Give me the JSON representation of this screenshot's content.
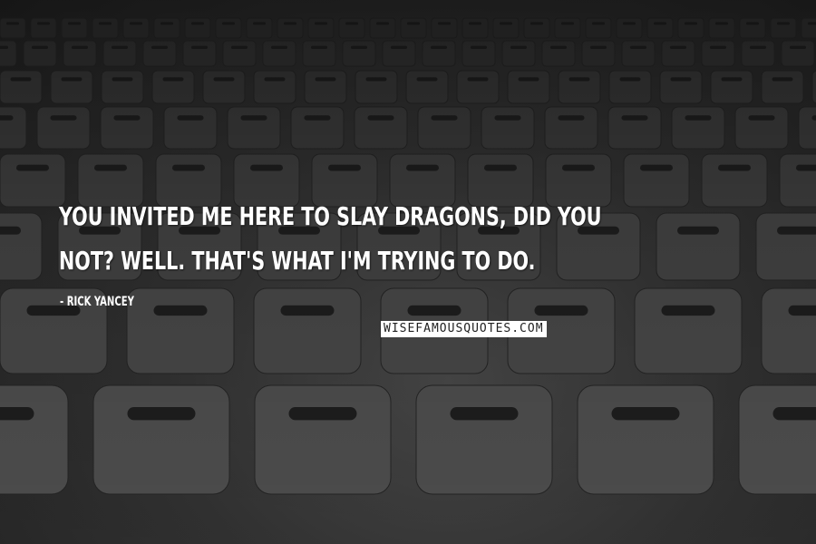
{
  "quote": {
    "text": "You invited me here to slay dragons, did you not? Well. That's what I'm trying to do.",
    "author": "- Rick Yancey"
  },
  "watermark": "wisefamousquotes.com",
  "background": {
    "scene": "rows-of-empty-chairs",
    "palette": [
      "#222222",
      "#333333",
      "#4a4a4a",
      "#5a5a5a"
    ]
  }
}
